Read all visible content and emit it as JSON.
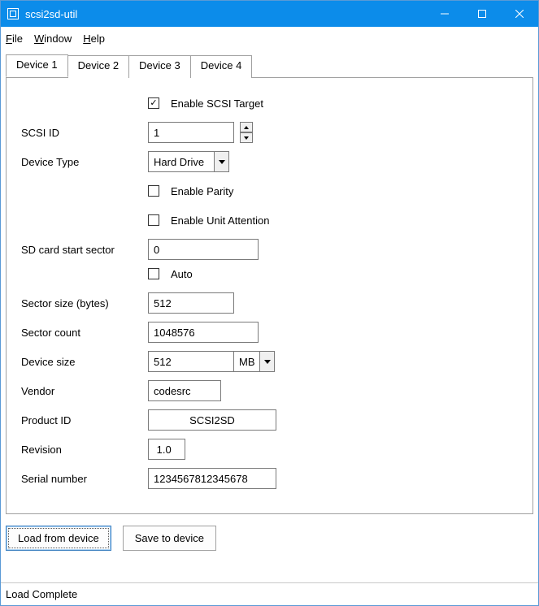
{
  "window": {
    "title": "scsi2sd-util"
  },
  "menu": {
    "file": "File",
    "window": "Window",
    "help": "Help"
  },
  "tabs": [
    "Device 1",
    "Device 2",
    "Device 3",
    "Device 4"
  ],
  "form": {
    "enable_scsi_target": {
      "label": "Enable SCSI Target",
      "checked": true
    },
    "scsi_id": {
      "label": "SCSI ID",
      "value": "1"
    },
    "device_type": {
      "label": "Device Type",
      "value": "Hard Drive"
    },
    "enable_parity": {
      "label": "Enable Parity",
      "checked": false
    },
    "enable_unit_attention": {
      "label": "Enable Unit Attention",
      "checked": false
    },
    "sd_start_sector": {
      "label": "SD card start sector",
      "value": "0"
    },
    "auto": {
      "label": "Auto",
      "checked": false
    },
    "sector_size": {
      "label": "Sector size (bytes)",
      "value": "512"
    },
    "sector_count": {
      "label": "Sector count",
      "value": "1048576"
    },
    "device_size": {
      "label": "Device size",
      "value": "512",
      "unit": "MB"
    },
    "vendor": {
      "label": "Vendor",
      "value": "codesrc"
    },
    "product_id": {
      "label": "Product ID",
      "value": "SCSI2SD"
    },
    "revision": {
      "label": "Revision",
      "value": " 1.0"
    },
    "serial": {
      "label": "Serial number",
      "value": "1234567812345678"
    }
  },
  "actions": {
    "load": "Load from device",
    "save": "Save to device"
  },
  "status": "Load Complete"
}
